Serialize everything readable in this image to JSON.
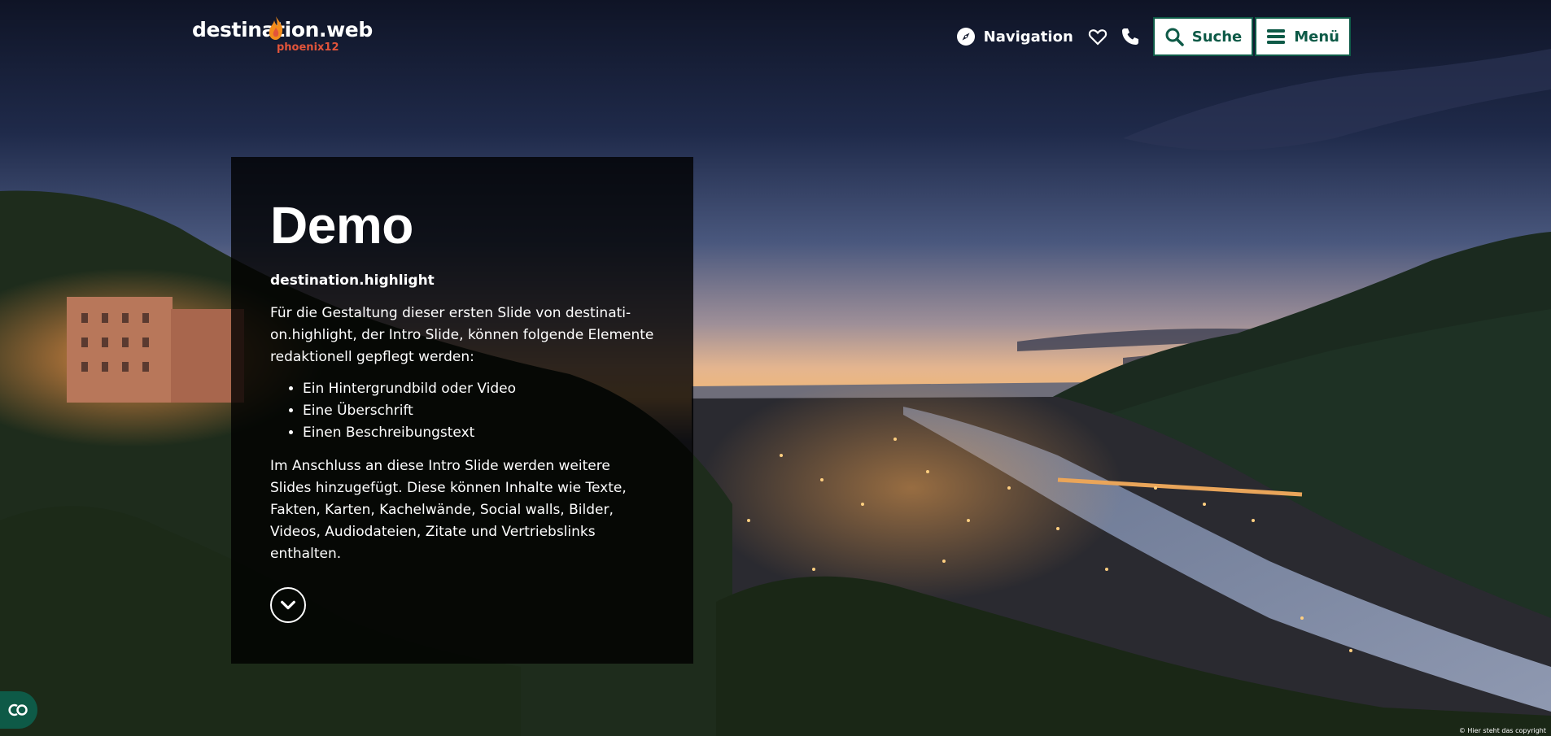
{
  "header": {
    "logo_main": "destination.web",
    "logo_sub": "phoenix12",
    "nav_label": "Navigation",
    "search_label": "Suche",
    "menu_label": "Menü"
  },
  "slide": {
    "title": "Demo",
    "subtitle": "destination.highlight",
    "intro": "Für die Gestaltung dieser ersten Slide von destinati­on.highlight, der Intro Slide, können folgende Elemente redaktionell gepflegt werden:",
    "items": [
      "Ein Hintergrundbild oder Video",
      "Eine Überschrift",
      "Einen Beschreibungstext"
    ],
    "outro": "Im Anschluss an diese Intro Slide werden weitere Slides hinzugefügt. Diese können Inhalte wie Texte, Fakten, Kar­ten, Kachelwände, Social walls, Bilder, Videos, Audioda­teien, Zitate und Vertriebslinks enthalten."
  },
  "footer": {
    "copyright": "© Hier steht das copyright"
  },
  "icons": {
    "compass": "compass-icon",
    "heart": "heart-icon",
    "phone": "phone-icon",
    "search": "search-icon",
    "menu": "hamburger-icon",
    "down": "chevron-down-icon",
    "cookie": "cookie-consent-icon"
  },
  "colors": {
    "brand_green": "#0e5a47",
    "logo_accent": "#e2543a"
  }
}
